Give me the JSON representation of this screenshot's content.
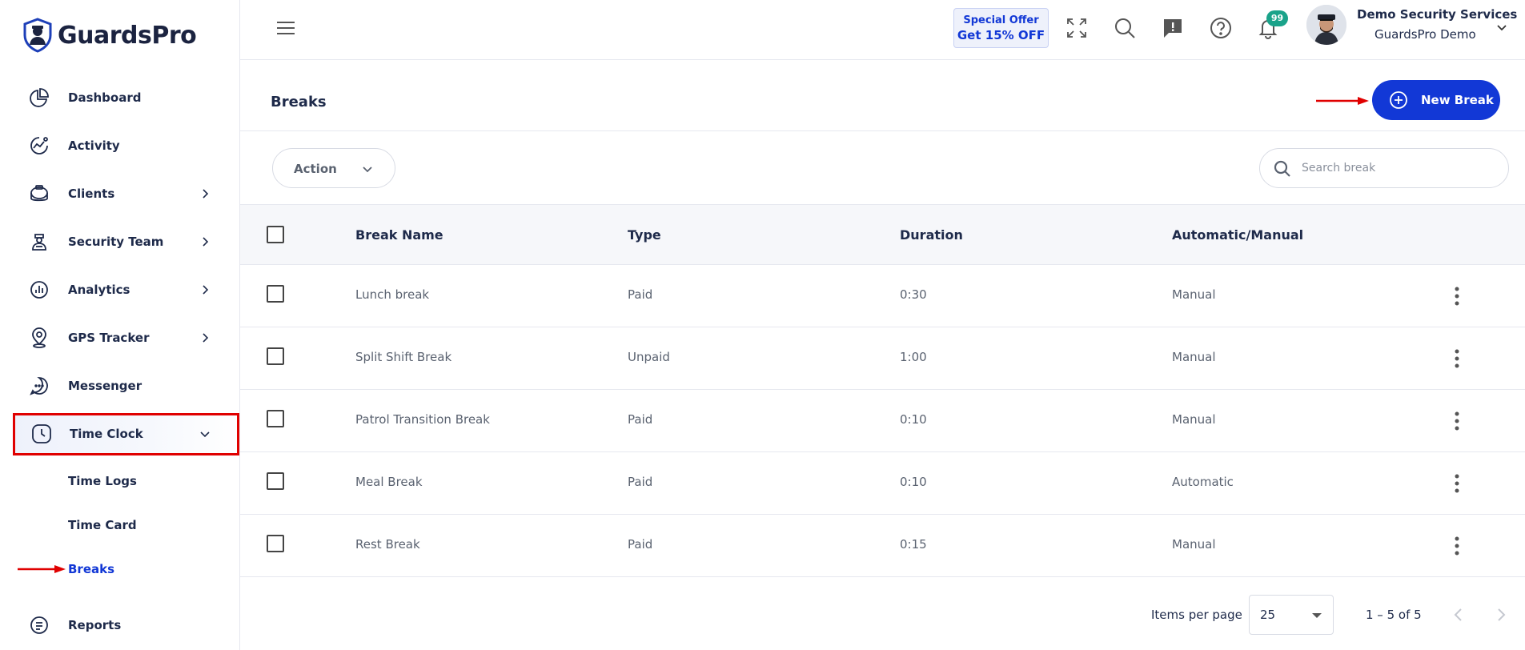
{
  "app": {
    "name": "GuardsPro"
  },
  "sidebar": {
    "items": [
      {
        "label": "Dashboard",
        "icon": "pie-chart-icon"
      },
      {
        "label": "Activity",
        "icon": "activity-icon"
      },
      {
        "label": "Clients",
        "icon": "briefcase-icon"
      },
      {
        "label": "Security Team",
        "icon": "guard-icon"
      },
      {
        "label": "Analytics",
        "icon": "analytics-icon"
      },
      {
        "label": "GPS Tracker",
        "icon": "location-pin-icon"
      },
      {
        "label": "Messenger",
        "icon": "chat-icon"
      },
      {
        "label": "Time Clock",
        "icon": "clock-icon"
      },
      {
        "label": "Reports",
        "icon": "reports-icon"
      }
    ],
    "time_clock_sub": [
      {
        "label": "Time Logs"
      },
      {
        "label": "Time Card"
      },
      {
        "label": "Breaks"
      }
    ]
  },
  "topbar": {
    "offer_line1": "Special Offer",
    "offer_line2": "Get 15% OFF",
    "notification_count": "99",
    "user_name": "Demo Security Services",
    "user_org": "GuardsPro Demo"
  },
  "page": {
    "title": "Breaks",
    "new_button_label": "New Break",
    "action_label": "Action",
    "search_placeholder": "Search break"
  },
  "table": {
    "headers": [
      "Break Name",
      "Type",
      "Duration",
      "Automatic/Manual"
    ],
    "rows": [
      {
        "name": "Lunch break",
        "type": "Paid",
        "duration": "0:30",
        "mode": "Manual"
      },
      {
        "name": "Split Shift Break",
        "type": "Unpaid",
        "duration": "1:00",
        "mode": "Manual"
      },
      {
        "name": "Patrol Transition Break",
        "type": "Paid",
        "duration": "0:10",
        "mode": "Manual"
      },
      {
        "name": "Meal Break",
        "type": "Paid",
        "duration": "0:10",
        "mode": "Automatic"
      },
      {
        "name": "Rest Break",
        "type": "Paid",
        "duration": "0:15",
        "mode": "Manual"
      }
    ]
  },
  "pagination": {
    "items_per_page_label": "Items per page",
    "items_per_page_value": "25",
    "range": "1 – 5 of 5"
  },
  "colors": {
    "primary": "#1238d6",
    "badge": "#1aa38a",
    "annotation_red": "#e00000"
  }
}
